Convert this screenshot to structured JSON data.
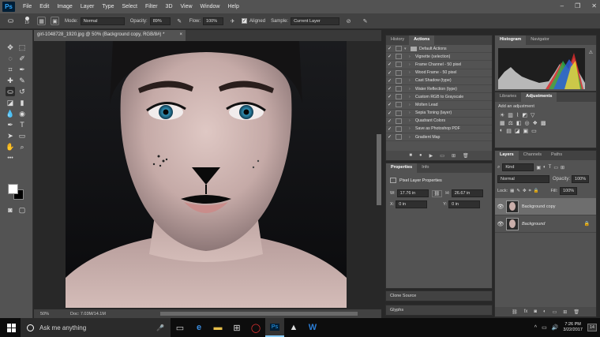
{
  "app": {
    "logo": "Ps",
    "menu": [
      "File",
      "Edit",
      "Image",
      "Layer",
      "Type",
      "Select",
      "Filter",
      "3D",
      "View",
      "Window",
      "Help"
    ],
    "window_controls": [
      "–",
      "❐",
      "✕"
    ]
  },
  "options_bar": {
    "brush_size": "19",
    "mode_label": "Mode:",
    "mode_value": "Normal",
    "opacity_label": "Opacity:",
    "opacity_value": "89%",
    "flow_label": "Flow:",
    "flow_value": "100%",
    "aligned_label": "Aligned",
    "sample_label": "Sample:",
    "sample_value": "Current Layer"
  },
  "document": {
    "tab_title": "girl-1048728_1920.jpg @ 50% (Background copy, RGB/8#) *",
    "tab_close": "×",
    "zoom": "50%",
    "doc_info": "Doc: 7.03M/14.1M"
  },
  "history_panel": {
    "tabs": [
      "History",
      "Actions"
    ],
    "active_tab": "Actions",
    "actions": [
      {
        "label": "Default Actions",
        "folder": true
      },
      {
        "label": "Vignette (selection)"
      },
      {
        "label": "Frame Channel - 50 pixel"
      },
      {
        "label": "Wood Frame - 50 pixel"
      },
      {
        "label": "Cast Shadow (type)"
      },
      {
        "label": "Water Reflection (type)"
      },
      {
        "label": "Custom RGB to Grayscale"
      },
      {
        "label": "Molten Lead"
      },
      {
        "label": "Sepia Toning (layer)"
      },
      {
        "label": "Quadrant Colors"
      },
      {
        "label": "Save as Photoshop PDF"
      },
      {
        "label": "Gradient Map"
      }
    ]
  },
  "properties_panel": {
    "tabs": [
      "Properties",
      "Info"
    ],
    "heading": "Pixel Layer Properties",
    "w_label": "W:",
    "w_value": "17.76 in",
    "h_label": "H:",
    "h_value": "26.67 in",
    "x_label": "X:",
    "x_value": "0 in",
    "y_label": "Y:",
    "y_value": "0 in"
  },
  "collapsed_panels": [
    "Clone Source",
    "Glyphs"
  ],
  "histogram_panel": {
    "tabs": [
      "Histogram",
      "Navigator"
    ]
  },
  "adjustments_panel": {
    "tabs": [
      "Libraries",
      "Adjustments"
    ],
    "heading": "Add an adjustment"
  },
  "layers_panel": {
    "tabs": [
      "Layers",
      "Channels",
      "Paths"
    ],
    "filter_value": "Kind",
    "blend_value": "Normal",
    "opacity_label": "Opacity:",
    "opacity_value": "100%",
    "lock_label": "Lock:",
    "fill_label": "Fill:",
    "fill_value": "100%",
    "layers": [
      {
        "name": "Background copy",
        "selected": true
      },
      {
        "name": "Background",
        "locked": true
      }
    ]
  },
  "taskbar": {
    "search_placeholder": "Ask me anything",
    "time": "7:26 PM",
    "date": "3/22/2017",
    "notification_count": "14"
  },
  "colors": {
    "menubar": "#535353",
    "panel": "#535353",
    "dark": "#282828",
    "selected_layer": "#6e6e6e",
    "taskbar": "#0d0d0d"
  }
}
